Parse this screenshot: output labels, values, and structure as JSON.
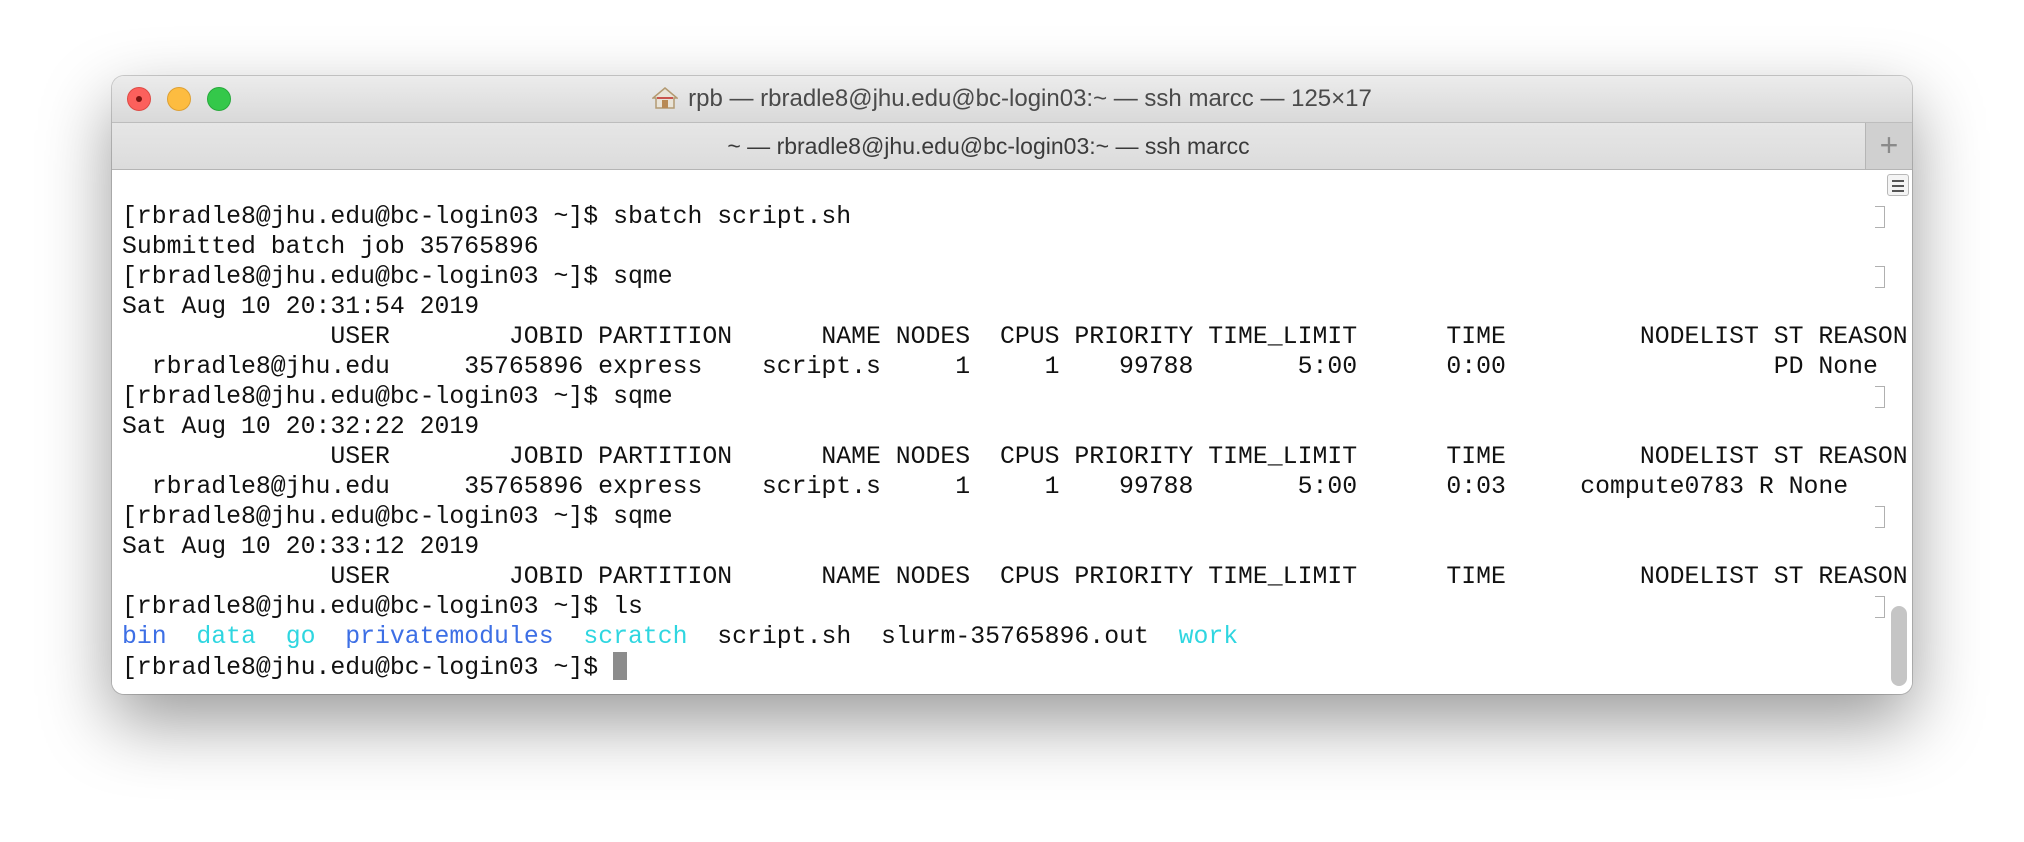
{
  "window": {
    "title": "rpb — rbradle8@jhu.edu@bc-login03:~ — ssh marcc — 125×17",
    "title_icon": "home-folder-icon",
    "tab_label": "~ — rbradle8@jhu.edu@bc-login03:~ — ssh marcc",
    "new_tab_icon": "plus-icon"
  },
  "colors": {
    "close": "#fc605c",
    "minimize": "#fdbc40",
    "zoom": "#34c84a",
    "dir_blue": "#3d6fe5",
    "dir_cyan": "#2fd6e0"
  },
  "terminal": {
    "prompt": "[rbradle8@jhu.edu@bc-login03 ~]$ ",
    "lines": [
      {
        "type": "prompt",
        "cmd": "sbatch script.sh"
      },
      {
        "type": "out",
        "text": "Submitted batch job 35765896"
      },
      {
        "type": "prompt",
        "cmd": "sqme"
      },
      {
        "type": "out",
        "text": "Sat Aug 10 20:31:54 2019"
      },
      {
        "type": "out",
        "text": "              USER        JOBID PARTITION      NAME NODES  CPUS PRIORITY TIME_LIMIT      TIME         NODELIST ST REASON"
      },
      {
        "type": "out",
        "text": "  rbradle8@jhu.edu     35765896 express    script.s     1     1    99788       5:00      0:00                  PD None"
      },
      {
        "type": "prompt",
        "cmd": "sqme"
      },
      {
        "type": "out",
        "text": "Sat Aug 10 20:32:22 2019"
      },
      {
        "type": "out",
        "text": "              USER        JOBID PARTITION      NAME NODES  CPUS PRIORITY TIME_LIMIT      TIME         NODELIST ST REASON"
      },
      {
        "type": "out",
        "text": "  rbradle8@jhu.edu     35765896 express    script.s     1     1    99788       5:00      0:03     compute0783 R None"
      },
      {
        "type": "prompt",
        "cmd": "sqme"
      },
      {
        "type": "out",
        "text": "Sat Aug 10 20:33:12 2019"
      },
      {
        "type": "out",
        "text": "              USER        JOBID PARTITION      NAME NODES  CPUS PRIORITY TIME_LIMIT      TIME         NODELIST ST REASON"
      },
      {
        "type": "prompt",
        "cmd": "ls"
      }
    ],
    "ls_output": [
      {
        "name": "bin",
        "color": "blue"
      },
      {
        "name": "data",
        "color": "cyan"
      },
      {
        "name": "go",
        "color": "cyan"
      },
      {
        "name": "privatemodules",
        "color": "blue"
      },
      {
        "name": "scratch",
        "color": "cyan"
      },
      {
        "name": "script.sh",
        "color": "plain"
      },
      {
        "name": "slurm-35765896.out",
        "color": "plain"
      },
      {
        "name": "work",
        "color": "cyan"
      }
    ],
    "current_prompt": "[rbradle8@jhu.edu@bc-login03 ~]$ "
  }
}
